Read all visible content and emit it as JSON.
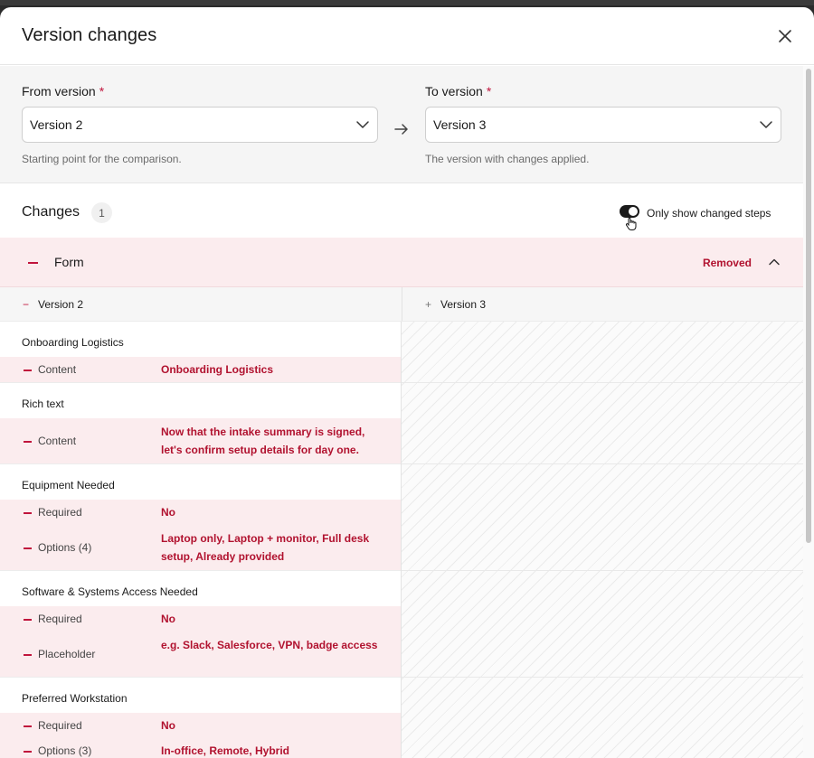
{
  "modal": {
    "title": "Version changes"
  },
  "version_picker": {
    "from": {
      "label": "From version",
      "required_mark": "*",
      "value": "Version 2",
      "help": "Starting point for the comparison."
    },
    "to": {
      "label": "To version",
      "required_mark": "*",
      "value": "Version 3",
      "help": "The version with changes applied."
    }
  },
  "changes": {
    "title": "Changes",
    "count": "1",
    "filter_label": "Only show changed steps",
    "filter_on": true
  },
  "step": {
    "name": "Form",
    "status": "Removed",
    "minus": "−"
  },
  "columns": {
    "left": {
      "sign": "−",
      "label": "Version 2"
    },
    "right": {
      "sign": "+",
      "label": "Version 3"
    }
  },
  "fields": [
    {
      "title": "Onboarding Logistics",
      "props": [
        {
          "name": "Content",
          "value": "Onboarding Logistics",
          "lines": 1
        }
      ]
    },
    {
      "title": "Rich text",
      "props": [
        {
          "name": "Content",
          "value": "Now that the intake summary is signed, let's confirm setup details for day one.",
          "lines": 2
        }
      ]
    },
    {
      "title": "Equipment Needed",
      "props": [
        {
          "name": "Required",
          "value": "No",
          "lines": 1
        },
        {
          "name": "Options (4)",
          "value": "Laptop only, Laptop + monitor, Full desk setup, Already provided",
          "lines": 2
        }
      ]
    },
    {
      "title": "Software & Systems Access Needed",
      "props": [
        {
          "name": "Required",
          "value": "No",
          "lines": 1
        },
        {
          "name": "Placeholder",
          "value": "e.g. Slack, Salesforce, VPN, badge access",
          "lines": 2
        }
      ]
    },
    {
      "title": "Preferred Workstation",
      "props": [
        {
          "name": "Required",
          "value": "No",
          "lines": 1
        },
        {
          "name": "Options (3)",
          "value": "In-office, Remote, Hybrid",
          "lines": 1
        }
      ]
    }
  ],
  "colors": {
    "removed": "#b1122f",
    "removed_bg": "#fbecee"
  }
}
